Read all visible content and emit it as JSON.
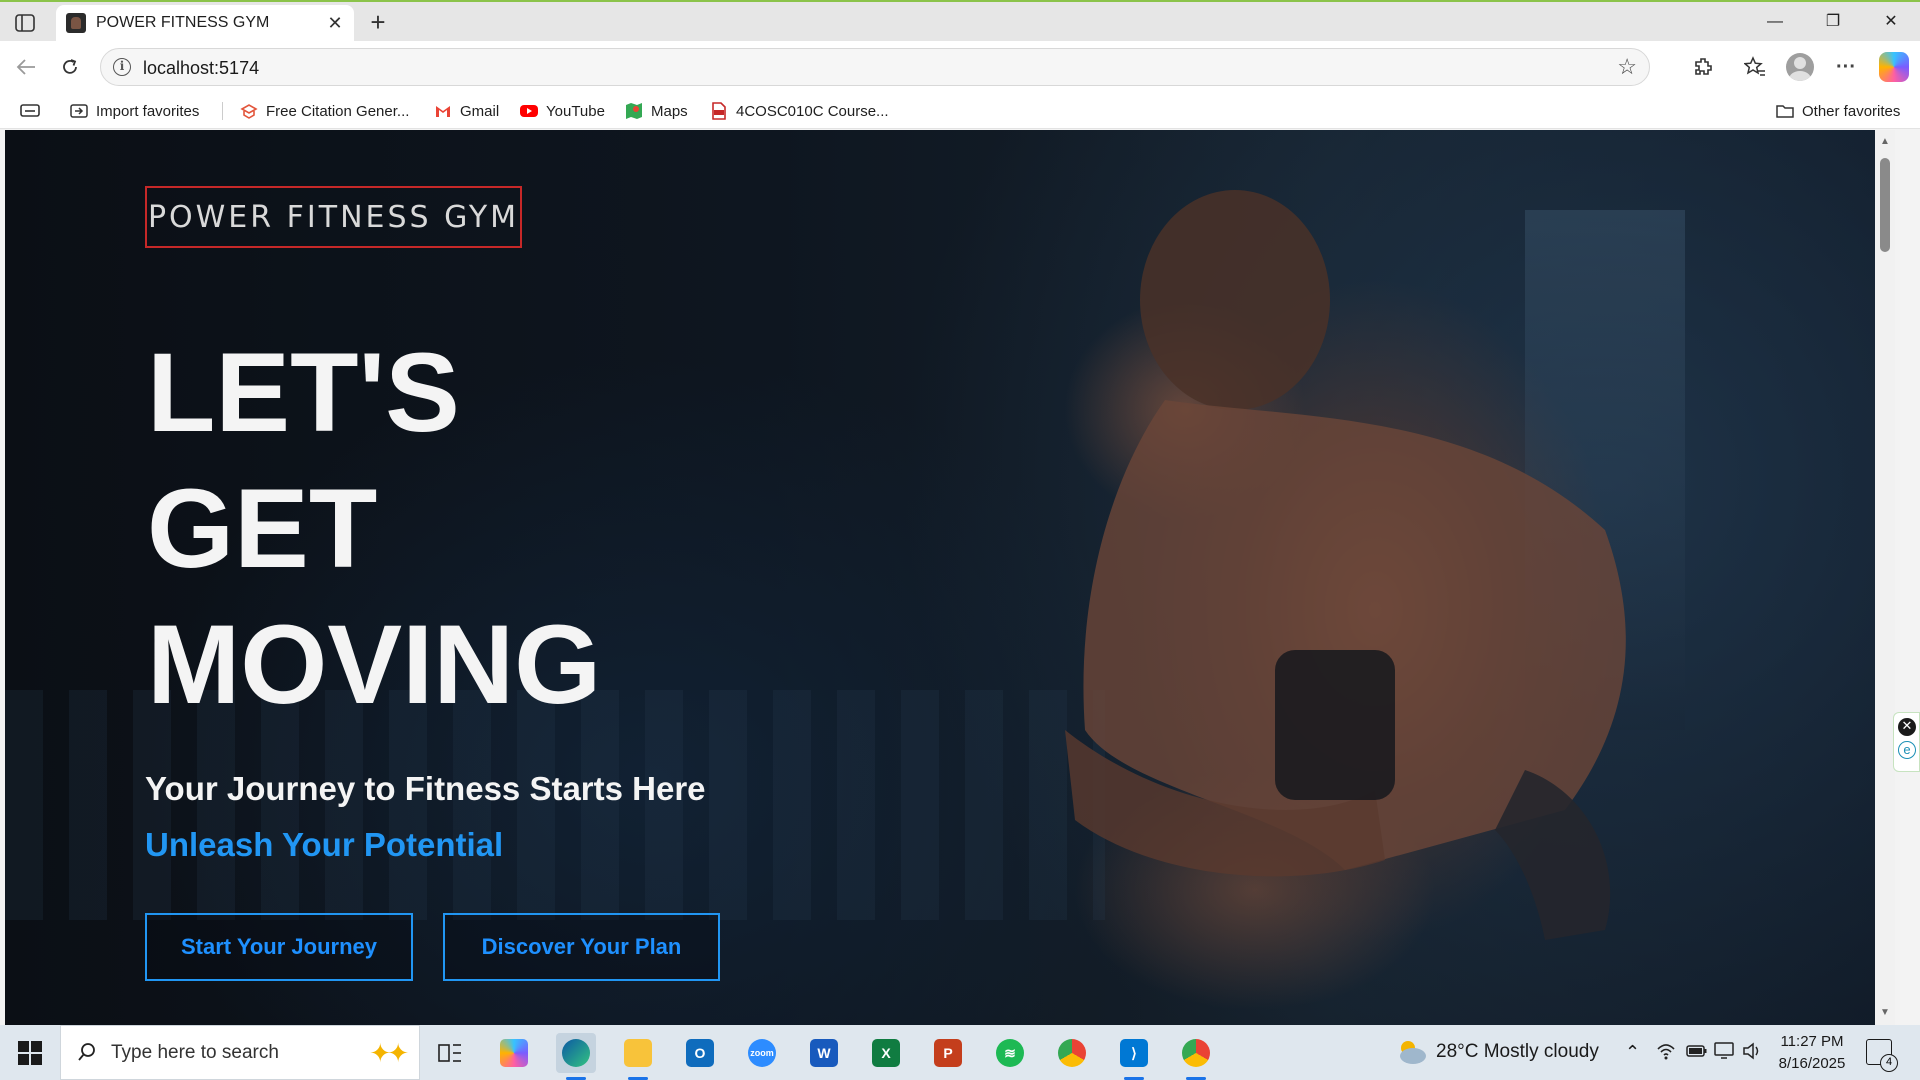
{
  "browser": {
    "tab_title": "POWER FITNESS GYM",
    "tab_close": "✕",
    "new_tab": "+",
    "url": "localhost:5174",
    "window_controls": {
      "minimize": "—",
      "restore": "❐",
      "close": "✕"
    },
    "more_menu": "···"
  },
  "favorites": {
    "items": [
      {
        "label": "Import favorites",
        "icon": "import-icon"
      },
      {
        "label": "Free Citation Gener...",
        "icon": "citation-icon"
      },
      {
        "label": "Gmail",
        "icon": "gmail-icon"
      },
      {
        "label": "YouTube",
        "icon": "youtube-icon"
      },
      {
        "label": "Maps",
        "icon": "maps-icon"
      },
      {
        "label": "4COSC010C Course...",
        "icon": "pdf-icon"
      }
    ],
    "other": "Other favorites"
  },
  "page": {
    "logo": "POWER FITNESS GYM",
    "hero_lines": [
      "LET'S",
      "GET",
      "MOVING"
    ],
    "subtitle": "Your Journey to Fitness Starts Here",
    "tagline": "Unleash Your Potential",
    "buttons": {
      "primary": "Start Your Journey",
      "secondary": "Discover Your Plan"
    },
    "accent_color": "#2196f3",
    "logo_border_color": "#c62828"
  },
  "taskbar": {
    "search_placeholder": "Type here to search",
    "apps": [
      "copilot",
      "task-view",
      "edge",
      "file-explorer",
      "outlook",
      "zoom",
      "word",
      "excel",
      "powerpoint",
      "spotify",
      "chrome",
      "vscode",
      "chrome-profile"
    ],
    "weather": "28°C  Mostly cloudy",
    "time": "11:27 PM",
    "date": "8/16/2025",
    "notification_count": "4"
  }
}
